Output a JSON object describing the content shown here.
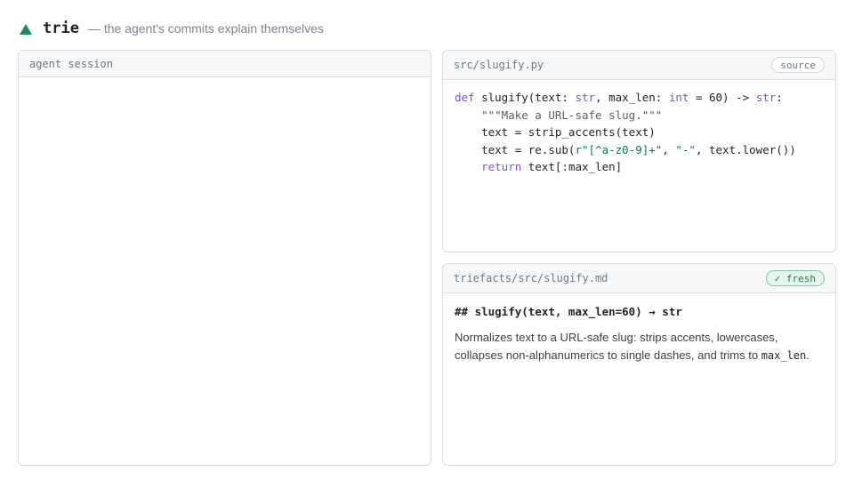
{
  "header": {
    "brand": "trie",
    "tagline": "— the agent's commits explain themselves",
    "logo_icon": "triangle-up-icon",
    "accent_color": "#1a8a5a"
  },
  "session_panel": {
    "title": "agent session"
  },
  "source_panel": {
    "title": "src/slugify.py",
    "badge": "source",
    "code": {
      "l1_kw_def": "def",
      "l1_a": " slugify(text: ",
      "l1_kw_str": "str",
      "l1_b": ", max_len: ",
      "l1_kw_int": "int",
      "l1_c": " = 60) -> ",
      "l1_kw_str2": "str",
      "l1_d": ":",
      "l2_doc": "    \"\"\"Make a URL-safe slug.\"\"\"",
      "l3": "    text = strip_accents(text)",
      "l4_a": "    text = re.sub(",
      "l4_str1": "r\"[^a-z0-9]+\"",
      "l4_b": ", ",
      "l4_str2": "\"-\"",
      "l4_c": ", text.lower())",
      "l5_indent": "    ",
      "l5_kw_return": "return",
      "l5_a": " text[:max_len]"
    }
  },
  "facts_panel": {
    "title": "triefacts/src/slugify.md",
    "badge": "✓ fresh",
    "heading": "## slugify(text, max_len=60) → str",
    "body_text": "Normalizes text to a URL-safe slug: strips accents, lowercases, collapses non-alphanumerics to single dashes, and trims to ",
    "body_code": "max_len",
    "body_end": "."
  }
}
